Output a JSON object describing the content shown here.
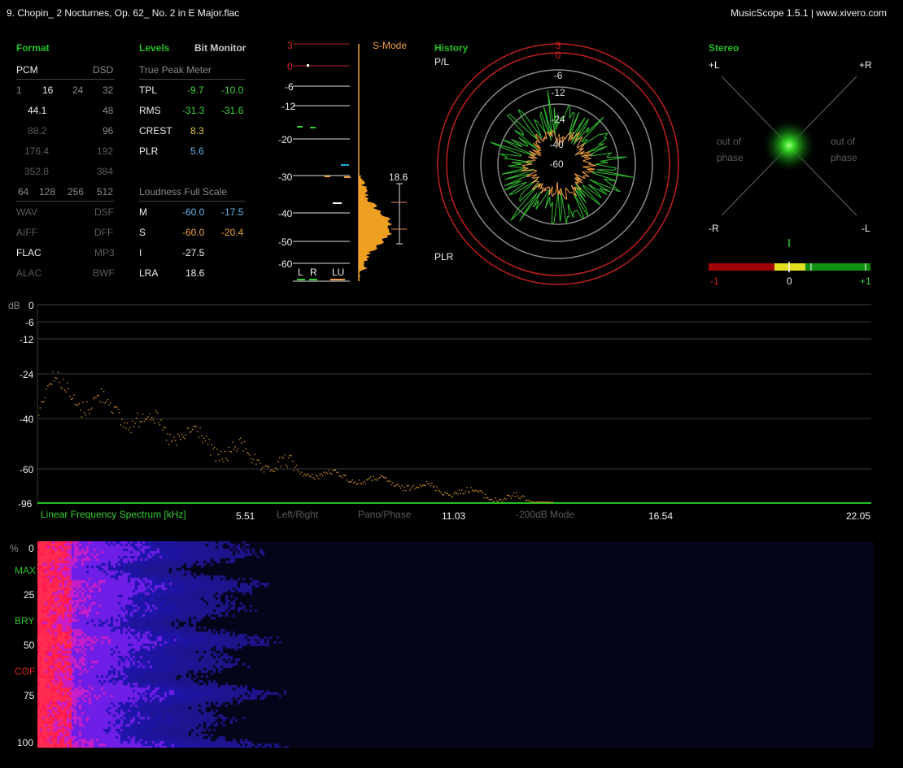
{
  "title": "9. Chopin_ 2 Nocturnes, Op. 62_ No. 2 in E Major.flac",
  "app": "MusicScope 1.5.1 | www.xivero.com",
  "colors": {
    "accent_green": "#22c022",
    "peak_orange": "#f0a040",
    "rms_green": "#3fd23f",
    "loud_blue": "#4aa8e0",
    "warning_red": "#e02020"
  },
  "format": {
    "header": "Format",
    "pcm": "PCM",
    "dsd": "DSD",
    "bits": [
      "1",
      "16",
      "24",
      "32"
    ],
    "rates": [
      [
        "44.1",
        "48"
      ],
      [
        "88.2",
        "96"
      ],
      [
        "176.4",
        "192"
      ],
      [
        "352.8",
        "384"
      ]
    ],
    "dsd_rates": [
      "64",
      "128",
      "256",
      "512"
    ],
    "containers": [
      [
        "WAV",
        "DSF"
      ],
      [
        "AIFF",
        "DFF"
      ],
      [
        "FLAC",
        "MP3"
      ],
      [
        "ALAC",
        "BWF"
      ]
    ]
  },
  "levels": {
    "header": "Levels",
    "bit_monitor": "Bit Monitor",
    "true_peak_label": "True Peak Meter",
    "tpl": {
      "label": "TPL",
      "l": "-9.7",
      "r": "-10.0"
    },
    "rms": {
      "label": "RMS",
      "l": "-31.3",
      "r": "-31.6"
    },
    "crest": {
      "label": "CREST",
      "v": "8.3"
    },
    "plr": {
      "label": "PLR",
      "v": "5.6"
    },
    "loudness_label": "Loudness Full Scale",
    "m": {
      "label": "M",
      "a": "-60.0",
      "b": "-17.5"
    },
    "s": {
      "label": "S",
      "a": "-60.0",
      "b": "-20.4"
    },
    "i": {
      "label": "I",
      "v": "-27.5"
    },
    "lra": {
      "label": "LRA",
      "v": "18.6"
    }
  },
  "meter": {
    "scale": [
      "3",
      "0",
      "-6",
      "-12",
      "-20",
      "-30",
      "-40",
      "-50",
      "-60"
    ],
    "mode": "S-Mode",
    "lra_value": "18.6",
    "channels": [
      "L",
      "R",
      "LU"
    ]
  },
  "history": {
    "header": "History",
    "pl": "P/L",
    "plr": "PLR",
    "rings": [
      "3",
      "0",
      "-6",
      "-12",
      "-24",
      "-40",
      "-60"
    ]
  },
  "stereo": {
    "header": "Stereo",
    "plus_l": "+L",
    "plus_r": "+R",
    "minus_r": "-R",
    "minus_l": "-L",
    "out_left": "out of\nphase",
    "out_right": "out of\nphase",
    "scale": [
      "-1",
      "0",
      "+1"
    ],
    "correlation": 0.0
  },
  "spectrum": {
    "db_label": "dB",
    "db_ticks": [
      "0",
      "-6",
      "-12",
      "-24",
      "-40",
      "-60",
      "-96"
    ],
    "title": "Linear Frequency Spectrum [kHz]",
    "freq_ticks": [
      "5.51",
      "11.03",
      "16.54",
      "22.05"
    ],
    "modes": [
      "Left/Right",
      "Pano/Phase",
      "-200dB Mode"
    ]
  },
  "spectrogram": {
    "pct": "%",
    "ticks": [
      "0",
      "25",
      "50",
      "75",
      "100"
    ],
    "markers": [
      {
        "label": "MAX",
        "color": "#22c022"
      },
      {
        "label": "BRY",
        "color": "#22c022"
      },
      {
        "label": "COF",
        "color": "#e02020"
      }
    ]
  }
}
